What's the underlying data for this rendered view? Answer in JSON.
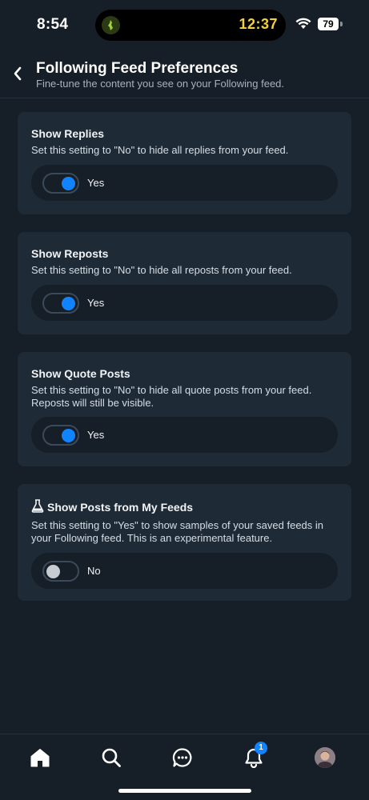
{
  "status_bar": {
    "time": "8:54",
    "timer": "12:37",
    "battery": "79"
  },
  "header": {
    "title": "Following Feed Preferences",
    "subtitle": "Fine-tune the content you see on your Following feed."
  },
  "settings": [
    {
      "title": "Show Replies",
      "description": "Set this setting to \"No\" to hide all replies from your feed.",
      "value_label": "Yes",
      "enabled": true
    },
    {
      "title": "Show Reposts",
      "description": "Set this setting to \"No\" to hide all reposts from your feed.",
      "value_label": "Yes",
      "enabled": true
    },
    {
      "title": "Show Quote Posts",
      "description": "Set this setting to \"No\" to hide all quote posts from your feed. Reposts will still be visible.",
      "value_label": "Yes",
      "enabled": true
    },
    {
      "title": "Show Posts from My Feeds",
      "description": "Set this setting to \"Yes\" to show samples of your saved feeds in your Following feed. This is an experimental feature.",
      "value_label": "No",
      "enabled": false,
      "icon": "flask-icon"
    }
  ],
  "bottom_nav": {
    "items": [
      "home-icon",
      "search-icon",
      "chat-icon",
      "bell-icon",
      "avatar"
    ],
    "notification_count": "1"
  },
  "colors": {
    "background": "#161e27",
    "card": "#1f2a37",
    "accent": "#1083fe",
    "timer": "#f4d03f"
  }
}
